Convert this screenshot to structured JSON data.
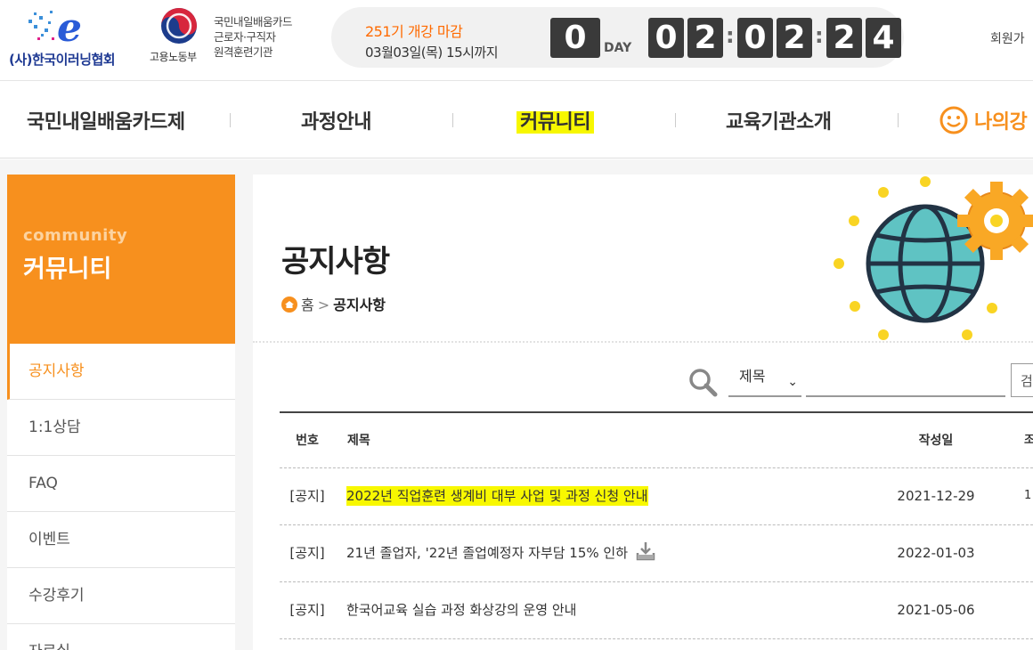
{
  "header": {
    "org_name": "(사)한국이러닝협회",
    "ministry_name": "고용노동부",
    "card_desc_line1": "국민내일배움카드",
    "card_desc_line2": "근로자·구직자",
    "card_desc_line3": "원격훈련기관",
    "countdown_title": "251기 개강 마감",
    "countdown_sub": "03월03일(목) 15시까지",
    "days": "0",
    "day_label": "DAY",
    "hours": [
      "0",
      "2"
    ],
    "minutes": [
      "0",
      "2"
    ],
    "seconds": [
      "2",
      "4"
    ],
    "member_link": "회원가"
  },
  "gnb": {
    "items": [
      "국민내일배움카드제",
      "과정안내",
      "커뮤니티",
      "교육기관소개",
      "나의강"
    ]
  },
  "sidebar": {
    "title_en": "community",
    "title_ko": "커뮤니티",
    "items": [
      "공지사항",
      "1:1상담",
      "FAQ",
      "이벤트",
      "수강후기",
      "자료실"
    ]
  },
  "main": {
    "page_title": "공지사항",
    "breadcrumb_home": "홈",
    "breadcrumb_current": "공지사항",
    "search": {
      "field_selected": "제목",
      "input_value": "",
      "button_label": "검"
    },
    "table": {
      "headers": {
        "no": "번호",
        "title": "제목",
        "date": "작성일",
        "extra": "조"
      },
      "rows": [
        {
          "no": "[공지]",
          "title": "2022년 직업훈련 생계비 대부 사업 및 과정 신청 안내",
          "date": "2021-12-29",
          "extra": "1",
          "highlighted": true,
          "attachment": false
        },
        {
          "no": "[공지]",
          "title": "21년 졸업자, '22년 졸업예정자 자부담 15% 인하",
          "date": "2022-01-03",
          "extra": "",
          "highlighted": false,
          "attachment": true
        },
        {
          "no": "[공지]",
          "title": "한국어교육 실습 과정 화상강의 운영 안내",
          "date": "2021-05-06",
          "extra": "",
          "highlighted": false,
          "attachment": false
        }
      ]
    }
  },
  "colors": {
    "accent_orange": "#f7901e",
    "countdown_orange": "#ff6a00",
    "highlight_yellow": "#f7f700",
    "brand_blue": "#1f3a93"
  }
}
